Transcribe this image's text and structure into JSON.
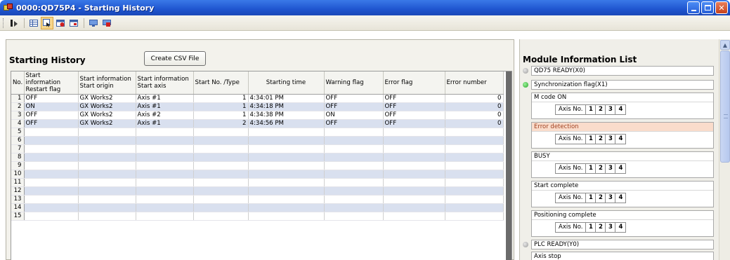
{
  "window": {
    "title": "0000:QD75P4 - Starting History",
    "colors": {
      "titlebar": "#2a63d9",
      "close": "#d4532a"
    }
  },
  "toolbar": {
    "icons": [
      "grip",
      "sort-icon",
      "table-icon",
      "history-icon",
      "error-icon",
      "window-icon",
      "monitor-icon",
      "stop-icon"
    ]
  },
  "left": {
    "title": "Starting History",
    "csv_button": "Create CSV File",
    "columns": [
      "No.",
      "Start information Restart flag",
      "Start information Start origin",
      "Start information Start axis",
      "Start No. /Type",
      "Starting time",
      "Warning flag",
      "Error flag",
      "Error number"
    ],
    "rows": [
      {
        "no": "1",
        "restart": "OFF",
        "origin": "GX Works2",
        "axis": "Axis #1",
        "startno": "1",
        "time": "4:34:01 PM",
        "warning": "OFF",
        "error": "OFF",
        "errno": "0"
      },
      {
        "no": "2",
        "restart": "ON",
        "origin": "GX Works2",
        "axis": "Axis #1",
        "startno": "1",
        "time": "4:34:18 PM",
        "warning": "OFF",
        "error": "OFF",
        "errno": "0"
      },
      {
        "no": "3",
        "restart": "OFF",
        "origin": "GX Works2",
        "axis": "Axis #2",
        "startno": "1",
        "time": "4:34:38 PM",
        "warning": "ON",
        "error": "OFF",
        "errno": "0"
      },
      {
        "no": "4",
        "restart": "OFF",
        "origin": "GX Works2",
        "axis": "Axis #1",
        "startno": "2",
        "time": "4:34:56 PM",
        "warning": "OFF",
        "error": "OFF",
        "errno": "0"
      },
      {
        "no": "5"
      },
      {
        "no": "6"
      },
      {
        "no": "7"
      },
      {
        "no": "8"
      },
      {
        "no": "9"
      },
      {
        "no": "10"
      },
      {
        "no": "11"
      },
      {
        "no": "12"
      },
      {
        "no": "13"
      },
      {
        "no": "14"
      },
      {
        "no": "15"
      }
    ]
  },
  "right": {
    "title": "Module Information List",
    "qd75_ready": {
      "label": "QD75 READY(X0)",
      "state": "off"
    },
    "sync_flag": {
      "label": "Synchronization flag(X1)",
      "state": "on"
    },
    "boxes": [
      {
        "label": "M code ON"
      },
      {
        "label": "Error detection",
        "highlight": true
      },
      {
        "label": "BUSY"
      },
      {
        "label": "Start complete"
      },
      {
        "label": "Positioning complete"
      }
    ],
    "axis_label": "Axis No.",
    "axis_numbers": [
      "1",
      "2",
      "3",
      "4"
    ],
    "plc_ready": {
      "label": "PLC READY(Y0)",
      "state": "off"
    },
    "axis_stop": {
      "label": "Axis stop"
    }
  }
}
